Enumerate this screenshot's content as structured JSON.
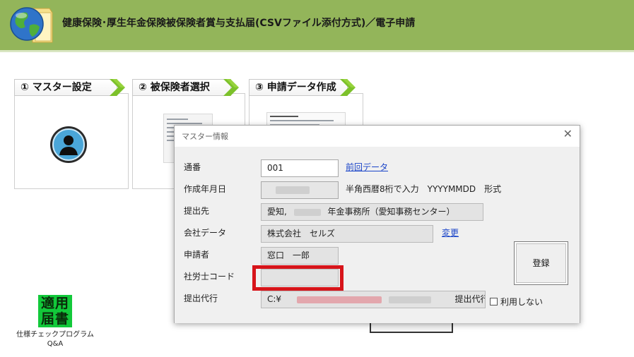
{
  "header": {
    "title": "健康保険･厚生年金保険被保険者賞与支払届(CSVファイル添付方式)／電子申請",
    "logo_icon": "globe-folder-icon"
  },
  "steps": [
    {
      "label": "① マスター設定"
    },
    {
      "label": "② 被保険者選択"
    },
    {
      "label": "③ 申請データ作成"
    }
  ],
  "tool": {
    "icon_line1": "適用",
    "icon_line2": "届書",
    "label_line1": "仕様チェックプログラム",
    "label_line2": "Q&A"
  },
  "dialog": {
    "title": "マスター情報",
    "close_glyph": "✕",
    "fields": {
      "serial": {
        "label": "通番",
        "value": "001"
      },
      "created": {
        "label": "作成年月日",
        "value": ""
      },
      "submit_to": {
        "label": "提出先",
        "value_prefix": "愛知,",
        "value_suffix": "年金事務所（愛知事務センター）"
      },
      "company": {
        "label": "会社データ",
        "value": "株式会社　セルズ"
      },
      "applicant": {
        "label": "申請者",
        "value": "窓口　一郎"
      },
      "sr_code": {
        "label": "社労士コード",
        "value": ""
      },
      "proxy": {
        "label": "提出代行",
        "value_prefix": "C:¥",
        "value_suffix": "提出代行.pdf"
      }
    },
    "prev_data_link": "前回データ",
    "date_hint": "半角西暦8桁で入力　YYYYMMDD　形式",
    "change_link": "変更",
    "register_button": "登録",
    "no_use_label": "利用しない"
  },
  "colors": {
    "header_bg": "#93b55a",
    "highlight": "#d7141a",
    "link": "#1a44c8"
  }
}
